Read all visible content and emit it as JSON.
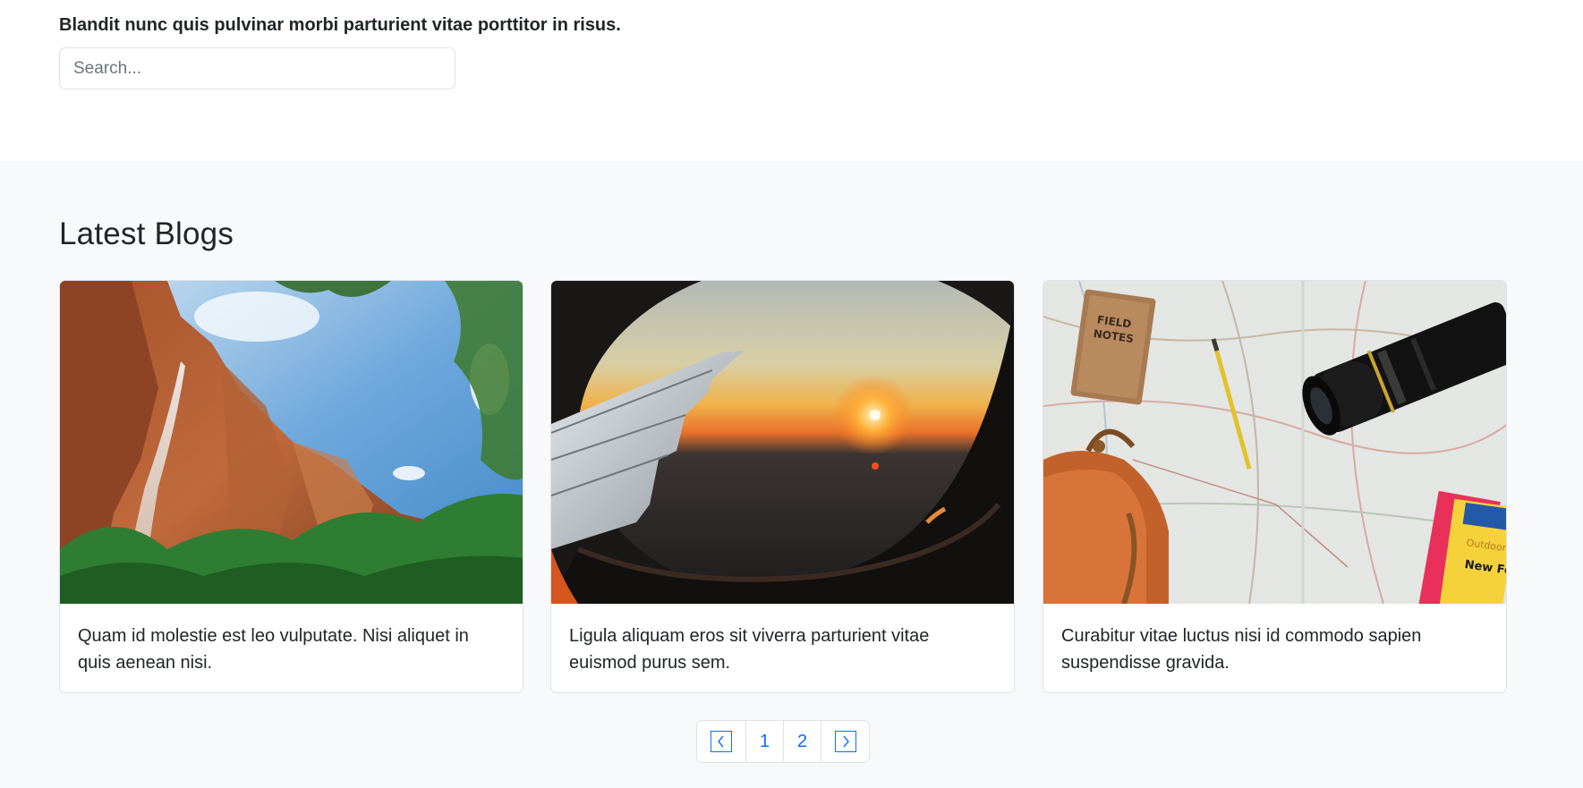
{
  "header": {
    "tagline": "Blandit nunc quis pulvinar morbi parturient vitae porttitor in risus.",
    "search_placeholder": "Search..."
  },
  "blogs": {
    "title": "Latest Blogs",
    "cards": [
      {
        "image": "canyon-waterfall-photo",
        "text": "Quam id molestie est leo vulputate. Nisi aliquet in quis aenean nisi."
      },
      {
        "image": "airplane-window-sunset-photo",
        "text": "Ligula aliquam eros sit viverra parturient vitae euismod purus sem."
      },
      {
        "image": "travel-map-camera-photo",
        "text": "Curabitur vitae luctus nisi id commodo sapien suspendisse gravida."
      }
    ]
  },
  "pagination": {
    "prev_icon": "chevron-left-icon",
    "pages": [
      "1",
      "2"
    ],
    "next_icon": "chevron-right-icon"
  },
  "colors": {
    "link": "#0d6efd",
    "section_background": "#f8f9fa",
    "border": "#dee2e6",
    "text": "#212529"
  }
}
